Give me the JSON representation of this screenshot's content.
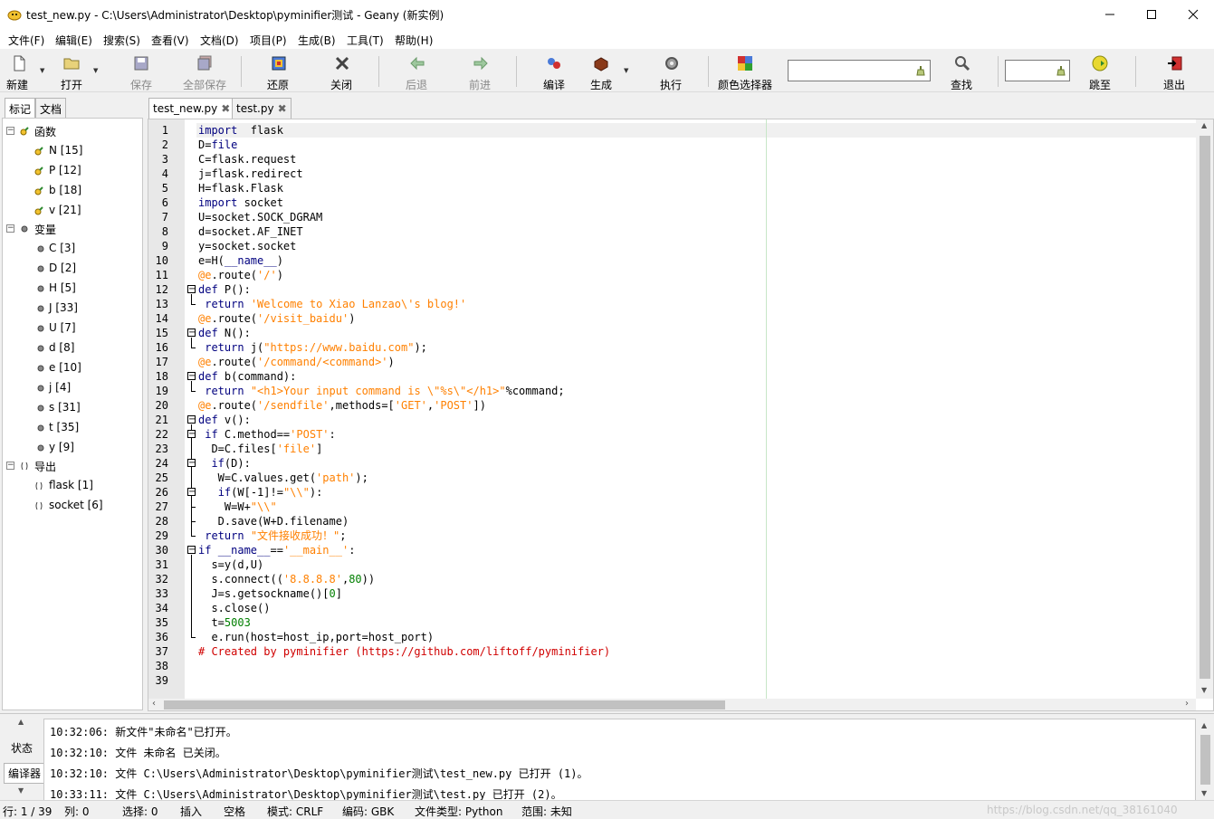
{
  "window": {
    "title": "test_new.py - C:\\Users\\Administrator\\Desktop\\pyminifier测试 - Geany (新实例)"
  },
  "menu": [
    "文件(F)",
    "编辑(E)",
    "搜索(S)",
    "查看(V)",
    "文档(D)",
    "项目(P)",
    "生成(B)",
    "工具(T)",
    "帮助(H)"
  ],
  "toolbar": {
    "new": "新建",
    "open": "打开",
    "save": "保存",
    "save_all": "全部保存",
    "revert": "还原",
    "close": "关闭",
    "back": "后退",
    "forward": "前进",
    "compile": "编译",
    "build": "生成",
    "execute": "执行",
    "color_picker": "颜色选择器",
    "search_value": "",
    "find": "查找",
    "goto_value": "",
    "goto": "跳至",
    "quit": "退出"
  },
  "sidebar": {
    "tabs": [
      "标记",
      "文档"
    ],
    "groups": [
      {
        "label": "函数",
        "items": [
          "N [15]",
          "P [12]",
          "b [18]",
          "v [21]"
        ]
      },
      {
        "label": "变量",
        "items": [
          "C [3]",
          "D [2]",
          "H [5]",
          "J [33]",
          "U [7]",
          "d [8]",
          "e [10]",
          "j [4]",
          "s [31]",
          "t [35]",
          "y [9]"
        ]
      },
      {
        "label": "导出",
        "items": [
          "flask [1]",
          "socket [6]"
        ]
      }
    ]
  },
  "documents": [
    {
      "name": "test_new.py",
      "active": true
    },
    {
      "name": "test.py",
      "active": false
    }
  ],
  "editor": {
    "lines": [
      [
        [
          "kw",
          "import"
        ],
        [
          "",
          "  flask"
        ]
      ],
      [
        [
          "",
          "D="
        ],
        [
          "kw",
          "file"
        ]
      ],
      [
        [
          "",
          "C=flask.request"
        ]
      ],
      [
        [
          "",
          "j=flask.redirect"
        ]
      ],
      [
        [
          "",
          "H=flask.Flask"
        ]
      ],
      [
        [
          "kw",
          "import"
        ],
        [
          "",
          " socket"
        ]
      ],
      [
        [
          "",
          "U=socket.SOCK_DGRAM"
        ]
      ],
      [
        [
          "",
          "d=socket.AF_INET"
        ]
      ],
      [
        [
          "",
          "y=socket.socket"
        ]
      ],
      [
        [
          "",
          "e=H("
        ],
        [
          "kw",
          "__name__"
        ],
        [
          "",
          ")"
        ]
      ],
      [
        [
          "dec",
          "@e"
        ],
        [
          "",
          ".route("
        ],
        [
          "str",
          "'/'"
        ],
        [
          "",
          ")"
        ]
      ],
      [
        [
          "kw",
          "def"
        ],
        [
          "",
          " P():"
        ]
      ],
      [
        [
          "",
          " "
        ],
        [
          "kw",
          "return"
        ],
        [
          "",
          " "
        ],
        [
          "str",
          "'Welcome to Xiao Lanzao\\'s blog!'"
        ]
      ],
      [
        [
          "dec",
          "@e"
        ],
        [
          "",
          ".route("
        ],
        [
          "str",
          "'/visit_baidu'"
        ],
        [
          "",
          ")"
        ]
      ],
      [
        [
          "kw",
          "def"
        ],
        [
          "",
          " N():"
        ]
      ],
      [
        [
          "",
          " "
        ],
        [
          "kw",
          "return"
        ],
        [
          "",
          " j("
        ],
        [
          "str",
          "\"https://www.baidu.com\""
        ],
        [
          "",
          ");"
        ]
      ],
      [
        [
          "dec",
          "@e"
        ],
        [
          "",
          ".route("
        ],
        [
          "str",
          "'/command/<command>'"
        ],
        [
          "",
          ")"
        ]
      ],
      [
        [
          "kw",
          "def"
        ],
        [
          "",
          " b(command):"
        ]
      ],
      [
        [
          "",
          " "
        ],
        [
          "kw",
          "return"
        ],
        [
          "",
          " "
        ],
        [
          "str",
          "\"<h1>Your input command is \\\"%s\\\"</h1>\""
        ],
        [
          "",
          "%command;"
        ]
      ],
      [
        [
          "dec",
          "@e"
        ],
        [
          "",
          ".route("
        ],
        [
          "str",
          "'/sendfile'"
        ],
        [
          "",
          ",methods=["
        ],
        [
          "str",
          "'GET'"
        ],
        [
          "",
          ","
        ],
        [
          "str",
          "'POST'"
        ],
        [
          "",
          "])"
        ]
      ],
      [
        [
          "kw",
          "def"
        ],
        [
          "",
          " v():"
        ]
      ],
      [
        [
          "",
          " "
        ],
        [
          "kw",
          "if"
        ],
        [
          "",
          " C.method=="
        ],
        [
          "str",
          "'POST'"
        ],
        [
          "",
          ":"
        ]
      ],
      [
        [
          "",
          "  D=C.files["
        ],
        [
          "str",
          "'file'"
        ],
        [
          "",
          "]"
        ]
      ],
      [
        [
          "",
          "  "
        ],
        [
          "kw",
          "if"
        ],
        [
          "",
          "(D):"
        ]
      ],
      [
        [
          "",
          "   W=C.values.get("
        ],
        [
          "str",
          "'path'"
        ],
        [
          "",
          ");"
        ]
      ],
      [
        [
          "",
          "   "
        ],
        [
          "kw",
          "if"
        ],
        [
          "",
          "(W[-1]!="
        ],
        [
          "str",
          "\"\\\\\""
        ],
        [
          "",
          "):"
        ]
      ],
      [
        [
          "",
          "    W=W+"
        ],
        [
          "str",
          "\"\\\\\""
        ]
      ],
      [
        [
          "",
          "   D.save(W+D.filename)"
        ]
      ],
      [
        [
          "",
          " "
        ],
        [
          "kw",
          "return"
        ],
        [
          "",
          " "
        ],
        [
          "str",
          "\"文件接收成功！\""
        ],
        [
          "",
          ";"
        ]
      ],
      [
        [
          "kw",
          "if"
        ],
        [
          "",
          " "
        ],
        [
          "kw",
          "__name__"
        ],
        [
          "",
          "=="
        ],
        [
          "str",
          "'__main__'"
        ],
        [
          "",
          ":"
        ]
      ],
      [
        [
          "",
          "  s=y(d,U)"
        ]
      ],
      [
        [
          "",
          "  s.connect(("
        ],
        [
          "str",
          "'8.8.8.8'"
        ],
        [
          "",
          ","
        ],
        [
          "num",
          "80"
        ],
        [
          "",
          "))"
        ]
      ],
      [
        [
          "",
          "  J=s.getsockname()["
        ],
        [
          "num",
          "0"
        ],
        [
          "",
          "]"
        ]
      ],
      [
        [
          "",
          "  s.close()"
        ]
      ],
      [
        [
          "",
          "  t="
        ],
        [
          "num",
          "5003"
        ]
      ],
      [
        [
          "",
          "  e.run(host=host_ip,port=host_port)"
        ]
      ],
      [
        [
          "cm",
          "# Created by pyminifier (https://github.com/liftoff/pyminifier)"
        ]
      ],
      [
        [
          "",
          ""
        ]
      ],
      [
        [
          "",
          ""
        ]
      ]
    ]
  },
  "messages": {
    "tabs": [
      "状态",
      "编译器"
    ],
    "items": [
      "10:32:06: 新文件\"未命名\"已打开。",
      "10:32:10: 文件 未命名 已关闭。",
      "10:32:10: 文件 C:\\Users\\Administrator\\Desktop\\pyminifier测试\\test_new.py 已打开 (1)。",
      "10:33:11: 文件 C:\\Users\\Administrator\\Desktop\\pyminifier测试\\test.py 已打开 (2)。"
    ]
  },
  "status": {
    "line": "行: 1 / 39",
    "col": "列: 0",
    "sel": "选择: 0",
    "insert": "插入",
    "space": "空格",
    "mode": "模式: CRLF",
    "encoding": "编码: GBK",
    "filetype": "文件类型: Python",
    "scope": "范围: 未知",
    "watermark": "https://blog.csdn.net/qq_38161040"
  }
}
